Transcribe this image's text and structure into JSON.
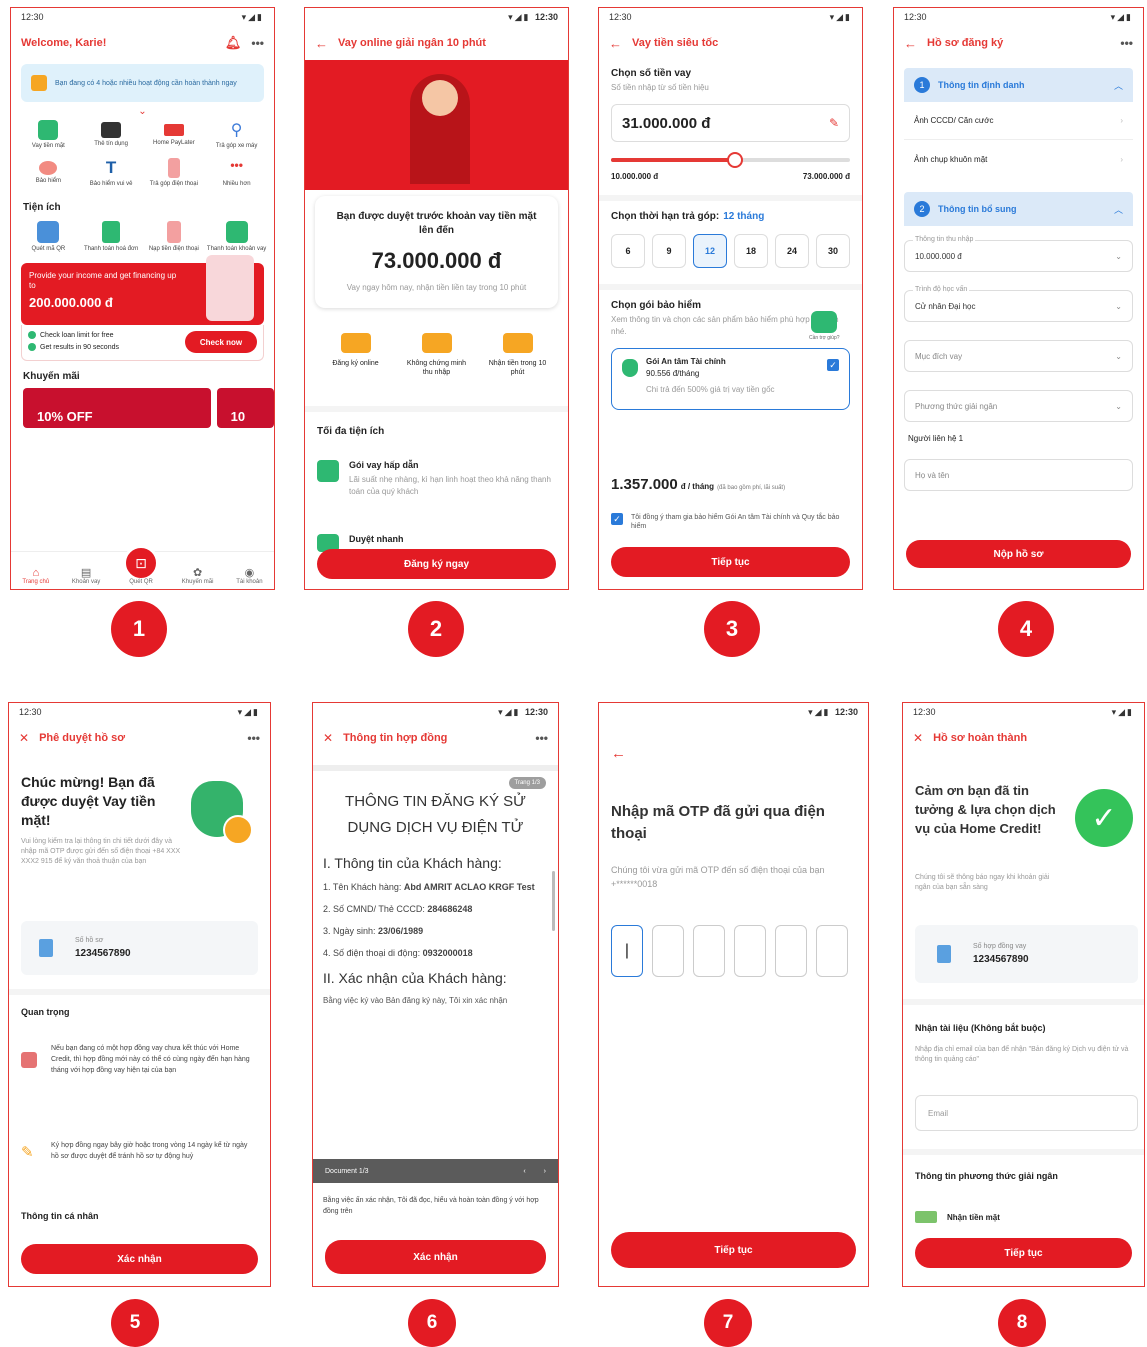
{
  "time": "12:30",
  "badges": [
    "1",
    "2",
    "3",
    "4",
    "5",
    "6",
    "7",
    "8"
  ],
  "s1": {
    "welcome": "Welcome, Karie!",
    "notice": "Bạn đang có 4 hoặc nhiều hoạt động cần hoàn thành ngay",
    "grid1": [
      {
        "label": "Vay tiền mặt",
        "icon": "cash-icon"
      },
      {
        "label": "Thẻ tín dụng",
        "icon": "card-icon"
      },
      {
        "label": "Home PayLater",
        "icon": "paylater-icon"
      },
      {
        "label": "Trả góp xe máy",
        "icon": "motorbike-icon"
      },
      {
        "label": "Bảo hiểm",
        "icon": "insurance-icon"
      },
      {
        "label": "Bảo hiểm vui vẻ",
        "icon": "umbrella-icon"
      },
      {
        "label": "Trả góp điện thoại",
        "icon": "phone-icon"
      },
      {
        "label": "Nhiều hơn",
        "icon": "more-icon"
      }
    ],
    "utilities_title": "Tiện ích",
    "grid2": [
      {
        "label": "Quét mã QR",
        "icon": "qr-icon"
      },
      {
        "label": "Thanh toán hoá đơn",
        "icon": "bill-icon"
      },
      {
        "label": "Nạp tiền điện thoại",
        "icon": "topup-icon"
      },
      {
        "label": "Thanh toán khoản vay",
        "icon": "loan-pay-icon"
      }
    ],
    "promo_line": "Provide your income and get financing up to",
    "promo_amount": "200.000.000 đ",
    "check1": "Check loan limit for free",
    "check2": "Get results in 90 seconds",
    "check_btn": "Check now",
    "promos_title": "Khuyến mãi",
    "off": "10% OFF",
    "off2": "10",
    "nav": [
      "Trang chủ",
      "Khoản vay",
      "Quét QR",
      "Khuyến mãi",
      "Tài khoản"
    ]
  },
  "s2": {
    "title": "Vay online giải ngân 10 phút",
    "approved": "Bạn được duyệt trước khoản vay tiền mặt lên đến",
    "amount": "73.000.000 đ",
    "sub": "Vay ngay hôm nay, nhận tiền liền tay trong 10 phút",
    "steps": [
      "Đăng ký online",
      "Không chứng minh thu nhập",
      "Nhận tiền trong 10 phút"
    ],
    "features_title": "Tối đa tiện ích",
    "f1_title": "Gói vay hấp dẫn",
    "f1_desc": "Lãi suất nhẹ nhàng, kì hạn linh hoạt theo khả năng thanh toán của quý khách",
    "f2_title": "Duyệt nhanh",
    "btn": "Đăng ký ngay"
  },
  "s3": {
    "title": "Vay tiền siêu tốc",
    "choose": "Chọn số tiền vay",
    "choose_sub": "Số tiền nhập từ số tiền hiệu",
    "amount": "31.000.000 đ",
    "min": "10.000.000 đ",
    "max": "73.000.000 đ",
    "term_title": "Chọn thời hạn trả góp:",
    "term_val": "12 tháng",
    "terms": [
      "6",
      "9",
      "12",
      "18",
      "24",
      "30"
    ],
    "chat": "Cần trợ giúp?",
    "ins_title": "Chọn gói bảo hiểm",
    "ins_sub": "Xem thông tin và chọn các sản phẩm bảo hiểm phù hợp với bạn nhé.",
    "ins_name": "Gói An tâm Tài chính",
    "ins_price": "90.556 đ/tháng",
    "ins_desc": "Chi trả đến 500% giá trị vay tiền gốc",
    "monthly": "1.357.000",
    "per": "đ / tháng",
    "per_small": "(đã bao gồm phí, lãi suất)",
    "consent": "Tôi đồng ý tham gia bảo hiểm Gói An tâm Tài chính và Quy tắc bảo hiểm",
    "btn": "Tiếp tục"
  },
  "s4": {
    "title": "Hồ sơ đăng ký",
    "sec1": "Thông tin định danh",
    "items": [
      "Ảnh CCCD/ Căn cước",
      "Ảnh chụp khuôn mặt"
    ],
    "sec2": "Thông tin bổ sung",
    "fields": [
      {
        "title": "Thông tin thu nhập",
        "value": "10.000.000 đ"
      },
      {
        "title": "Trình độ học vấn",
        "value": "Cử nhân Đại học"
      },
      {
        "title": "",
        "value": "Mục đích vay"
      },
      {
        "title": "",
        "value": "Phương thức giải ngân"
      }
    ],
    "contact": "Người liên hệ 1",
    "name_ph": "Họ và tên",
    "btn": "Nộp hồ sơ"
  },
  "s5": {
    "title": "Phê duyệt hồ sơ",
    "congrats": "Chúc mừng! Bạn đã được duyệt Vay tiền mặt!",
    "desc": "Vui lòng kiểm tra lại thông tin chi tiết dưới đây và nhập mã OTP được gửi đến số điện thoại +84 XXX XXX2 915 để ký văn thoả thuận của bạn",
    "file_label": "Số hồ sơ",
    "file_no": "1234567890",
    "important": "Quan trọng",
    "note1": "Nếu bạn đang có một hợp đồng vay chưa kết thúc với Home Credit, thì hợp đồng mới này có thể có cùng ngày đến hạn hàng tháng với hợp đồng vay hiện tại của bạn",
    "note2": "Ký hợp đồng ngay bây giờ hoặc trong vòng 14 ngày kể từ ngày hồ sơ được duyệt để tránh hồ sơ tự động huỷ",
    "personal": "Thông tin cá nhân",
    "btn": "Xác nhận"
  },
  "s6": {
    "title": "Thông tin hợp đồng",
    "page": "Trang 1/3",
    "doc_title": "THÔNG TIN ĐĂNG KÝ SỬ DỤNG DỊCH VỤ ĐIỆN TỬ",
    "sec1": "I. Thông tin của Khách hàng:",
    "lines": [
      {
        "k": "1. Tên Khách hàng:",
        "v": "Abd AMRIT ACLAO KRGF Test"
      },
      {
        "k": "2. Số CMND/ Thẻ CCCD:",
        "v": "284686248"
      },
      {
        "k": "3. Ngày sinh:",
        "v": "23/06/1989"
      },
      {
        "k": "4. Số điện thoại di động:",
        "v": "0932000018"
      }
    ],
    "sec2": "II. Xác nhận của Khách hàng:",
    "sec2_text": "Bằng việc ký vào Bản đăng ký này, Tôi xin xác nhận",
    "doc_bar": "Document 1/3",
    "confirm_text": "Bằng việc ấn xác nhận, Tôi đã đọc, hiểu và hoàn toàn đồng ý với hợp đồng trên",
    "btn": "Xác nhận"
  },
  "s7": {
    "title": "Nhập mã OTP đã gửi qua điện thoại",
    "sub": "Chúng tôi vừa gửi mã OTP đến số điện thoại của bạn +******0018",
    "btn": "Tiếp tục"
  },
  "s8": {
    "title": "Hồ sơ hoàn thành",
    "thanks": "Cảm ơn bạn đã tin tưởng & lựa chọn dịch vụ của Home Credit!",
    "sub": "Chúng tôi sẽ thông báo ngay khi khoản giải ngân của bạn sẵn sàng",
    "file_label": "Số hợp đồng vay",
    "file_no": "1234567890",
    "docs": "Nhận tài liệu (Không bắt buộc)",
    "docs_sub": "Nhập địa chỉ email của bạn để nhận \"Bản đăng ký Dịch vụ điện tử và thông tin quảng cáo\"",
    "email_ph": "Email",
    "disb": "Thông tin phương thức giải ngân",
    "cash": "Nhận tiền mặt",
    "btn": "Tiếp tục"
  }
}
